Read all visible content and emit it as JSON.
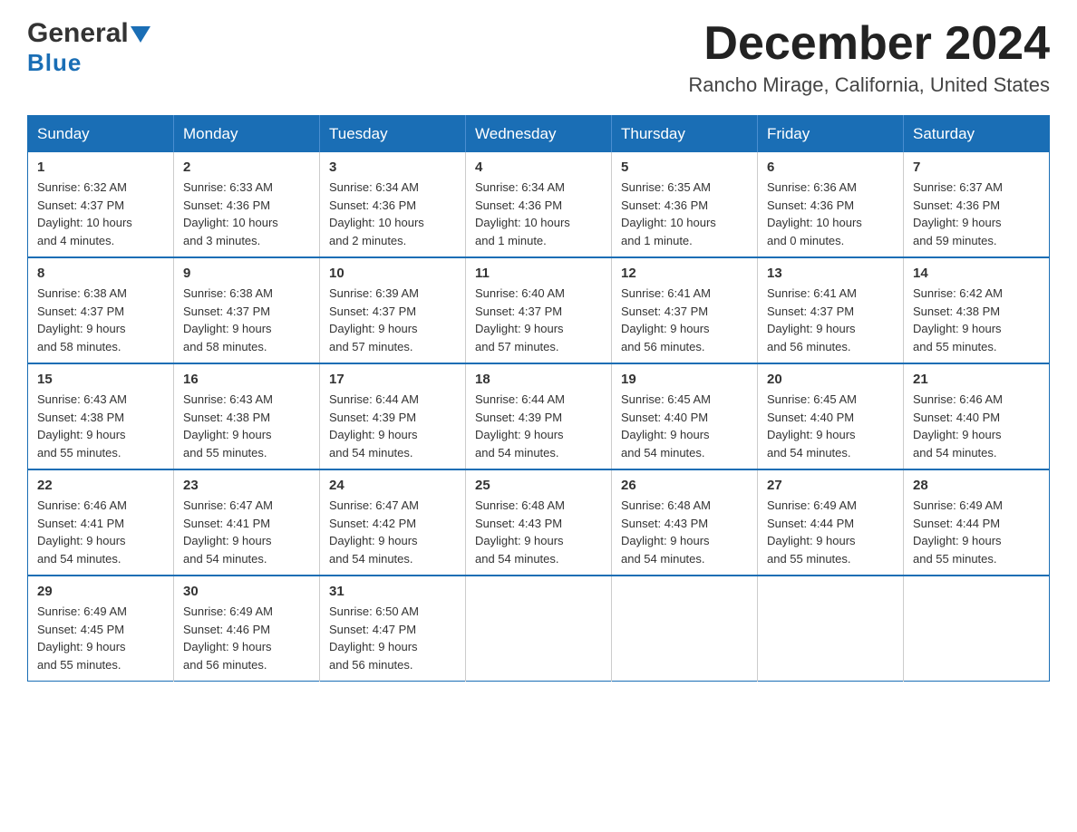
{
  "header": {
    "logo_general": "General",
    "logo_blue": "Blue",
    "month_year": "December 2024",
    "location": "Rancho Mirage, California, United States"
  },
  "days_of_week": [
    "Sunday",
    "Monday",
    "Tuesday",
    "Wednesday",
    "Thursday",
    "Friday",
    "Saturday"
  ],
  "weeks": [
    [
      {
        "day": "1",
        "sunrise": "6:32 AM",
        "sunset": "4:37 PM",
        "daylight": "10 hours and 4 minutes."
      },
      {
        "day": "2",
        "sunrise": "6:33 AM",
        "sunset": "4:36 PM",
        "daylight": "10 hours and 3 minutes."
      },
      {
        "day": "3",
        "sunrise": "6:34 AM",
        "sunset": "4:36 PM",
        "daylight": "10 hours and 2 minutes."
      },
      {
        "day": "4",
        "sunrise": "6:34 AM",
        "sunset": "4:36 PM",
        "daylight": "10 hours and 1 minute."
      },
      {
        "day": "5",
        "sunrise": "6:35 AM",
        "sunset": "4:36 PM",
        "daylight": "10 hours and 1 minute."
      },
      {
        "day": "6",
        "sunrise": "6:36 AM",
        "sunset": "4:36 PM",
        "daylight": "10 hours and 0 minutes."
      },
      {
        "day": "7",
        "sunrise": "6:37 AM",
        "sunset": "4:36 PM",
        "daylight": "9 hours and 59 minutes."
      }
    ],
    [
      {
        "day": "8",
        "sunrise": "6:38 AM",
        "sunset": "4:37 PM",
        "daylight": "9 hours and 58 minutes."
      },
      {
        "day": "9",
        "sunrise": "6:38 AM",
        "sunset": "4:37 PM",
        "daylight": "9 hours and 58 minutes."
      },
      {
        "day": "10",
        "sunrise": "6:39 AM",
        "sunset": "4:37 PM",
        "daylight": "9 hours and 57 minutes."
      },
      {
        "day": "11",
        "sunrise": "6:40 AM",
        "sunset": "4:37 PM",
        "daylight": "9 hours and 57 minutes."
      },
      {
        "day": "12",
        "sunrise": "6:41 AM",
        "sunset": "4:37 PM",
        "daylight": "9 hours and 56 minutes."
      },
      {
        "day": "13",
        "sunrise": "6:41 AM",
        "sunset": "4:37 PM",
        "daylight": "9 hours and 56 minutes."
      },
      {
        "day": "14",
        "sunrise": "6:42 AM",
        "sunset": "4:38 PM",
        "daylight": "9 hours and 55 minutes."
      }
    ],
    [
      {
        "day": "15",
        "sunrise": "6:43 AM",
        "sunset": "4:38 PM",
        "daylight": "9 hours and 55 minutes."
      },
      {
        "day": "16",
        "sunrise": "6:43 AM",
        "sunset": "4:38 PM",
        "daylight": "9 hours and 55 minutes."
      },
      {
        "day": "17",
        "sunrise": "6:44 AM",
        "sunset": "4:39 PM",
        "daylight": "9 hours and 54 minutes."
      },
      {
        "day": "18",
        "sunrise": "6:44 AM",
        "sunset": "4:39 PM",
        "daylight": "9 hours and 54 minutes."
      },
      {
        "day": "19",
        "sunrise": "6:45 AM",
        "sunset": "4:40 PM",
        "daylight": "9 hours and 54 minutes."
      },
      {
        "day": "20",
        "sunrise": "6:45 AM",
        "sunset": "4:40 PM",
        "daylight": "9 hours and 54 minutes."
      },
      {
        "day": "21",
        "sunrise": "6:46 AM",
        "sunset": "4:40 PM",
        "daylight": "9 hours and 54 minutes."
      }
    ],
    [
      {
        "day": "22",
        "sunrise": "6:46 AM",
        "sunset": "4:41 PM",
        "daylight": "9 hours and 54 minutes."
      },
      {
        "day": "23",
        "sunrise": "6:47 AM",
        "sunset": "4:41 PM",
        "daylight": "9 hours and 54 minutes."
      },
      {
        "day": "24",
        "sunrise": "6:47 AM",
        "sunset": "4:42 PM",
        "daylight": "9 hours and 54 minutes."
      },
      {
        "day": "25",
        "sunrise": "6:48 AM",
        "sunset": "4:43 PM",
        "daylight": "9 hours and 54 minutes."
      },
      {
        "day": "26",
        "sunrise": "6:48 AM",
        "sunset": "4:43 PM",
        "daylight": "9 hours and 54 minutes."
      },
      {
        "day": "27",
        "sunrise": "6:49 AM",
        "sunset": "4:44 PM",
        "daylight": "9 hours and 55 minutes."
      },
      {
        "day": "28",
        "sunrise": "6:49 AM",
        "sunset": "4:44 PM",
        "daylight": "9 hours and 55 minutes."
      }
    ],
    [
      {
        "day": "29",
        "sunrise": "6:49 AM",
        "sunset": "4:45 PM",
        "daylight": "9 hours and 55 minutes."
      },
      {
        "day": "30",
        "sunrise": "6:49 AM",
        "sunset": "4:46 PM",
        "daylight": "9 hours and 56 minutes."
      },
      {
        "day": "31",
        "sunrise": "6:50 AM",
        "sunset": "4:47 PM",
        "daylight": "9 hours and 56 minutes."
      },
      null,
      null,
      null,
      null
    ]
  ],
  "labels": {
    "sunrise": "Sunrise:",
    "sunset": "Sunset:",
    "daylight": "Daylight:"
  }
}
